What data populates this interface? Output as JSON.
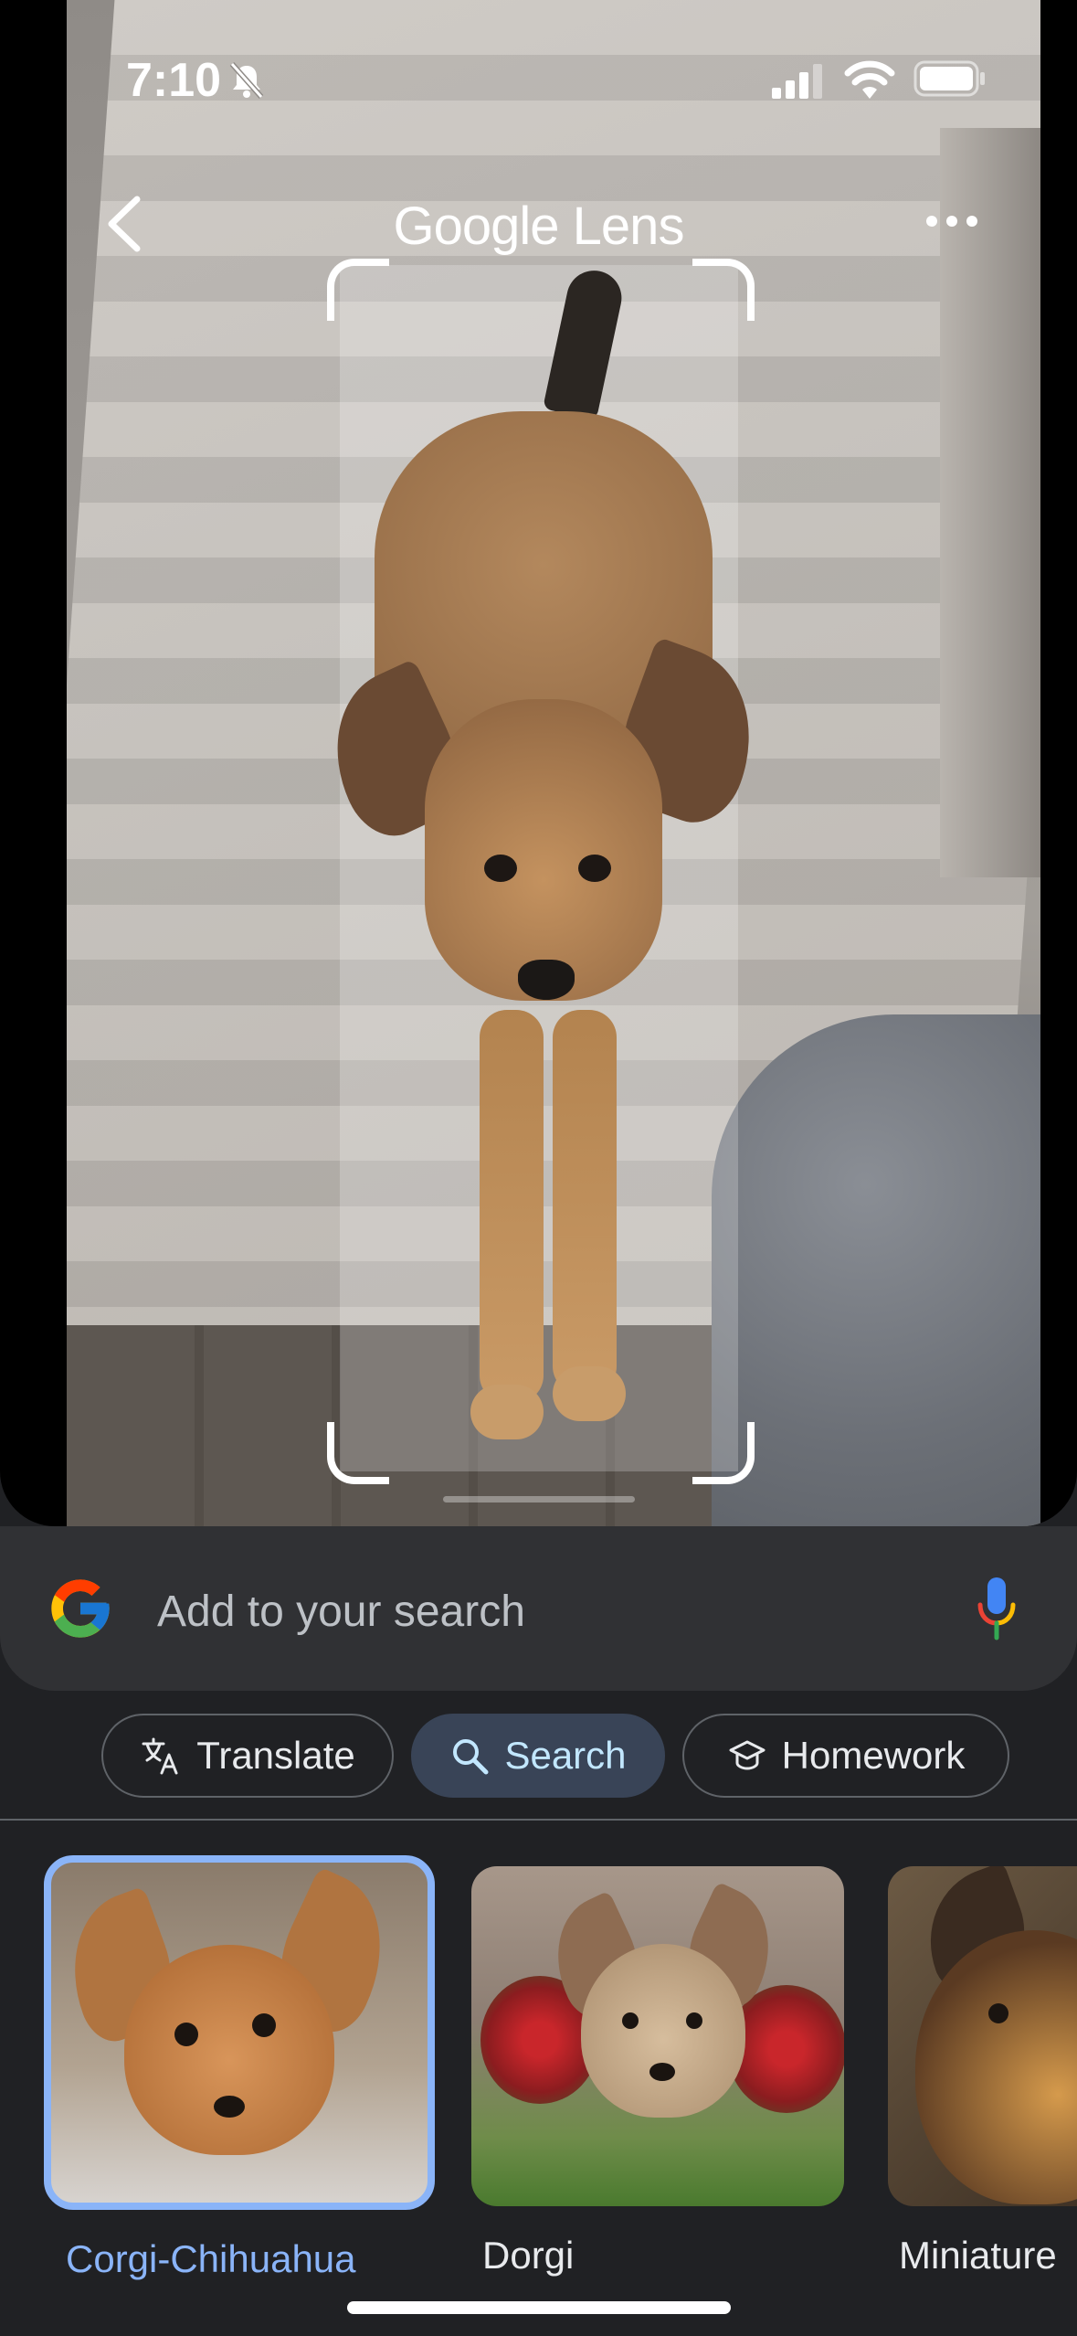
{
  "status_bar": {
    "time": "7:10"
  },
  "header": {
    "title": "Google Lens"
  },
  "search": {
    "placeholder": "Add to your search"
  },
  "chips": [
    {
      "label": "Translate",
      "icon": "translate-icon"
    },
    {
      "label": "Search",
      "icon": "search-icon",
      "selected": true
    },
    {
      "label": "Homework",
      "icon": "homework-icon"
    }
  ],
  "results": [
    {
      "label": "Corgi-Chihuahua",
      "selected": true
    },
    {
      "label": "Dorgi"
    },
    {
      "label": "Miniature"
    }
  ],
  "colors": {
    "accent": "#8ab4f8",
    "chip_selected_bg": "#394457",
    "panel_bg": "#202124",
    "search_bg": "#303134"
  }
}
